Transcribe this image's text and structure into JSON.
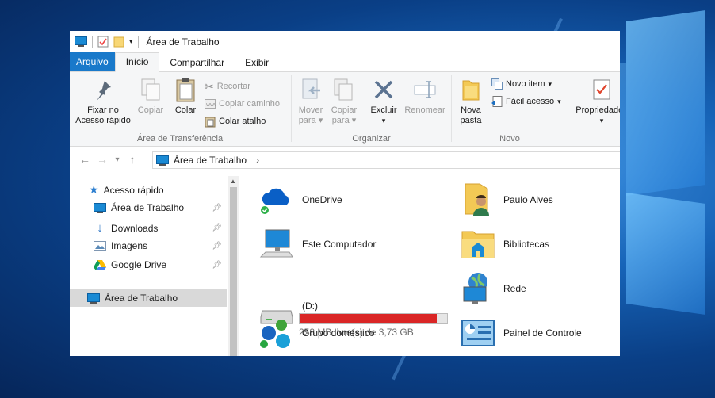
{
  "window": {
    "title": "Área de Trabalho"
  },
  "tabs": {
    "file": "Arquivo",
    "home": "Início",
    "share": "Compartilhar",
    "view": "Exibir"
  },
  "ribbon": {
    "pin": "Fixar no Acesso rápido",
    "copy": "Copiar",
    "paste": "Colar",
    "cut": "Recortar",
    "copy_path": "Copiar caminho",
    "paste_shortcut": "Colar atalho",
    "clipboard_label": "Área de Transferência",
    "move_to": "Mover para",
    "copy_to": "Copiar para",
    "delete": "Excluir",
    "rename": "Renomear",
    "organize_label": "Organizar",
    "new_folder": "Nova pasta",
    "new_item": "Novo item",
    "easy_access": "Fácil acesso",
    "new_label": "Novo",
    "properties": "Propriedades"
  },
  "address": {
    "path": "Área de Trabalho",
    "chevron": "›"
  },
  "nav": {
    "quick_access": "Acesso rápido",
    "items": [
      "Área de Trabalho",
      "Downloads",
      "Imagens",
      "Google Drive"
    ],
    "desktop": "Área de Trabalho"
  },
  "items": {
    "onedrive": "OneDrive",
    "user": "Paulo Alves",
    "computer": "Este Computador",
    "libraries": "Bibliotecas",
    "drive_name": "(D:)",
    "drive_free": "258 MB livre(s) de 3,73 GB",
    "drive_used_fraction": 0.93,
    "network": "Rede",
    "homegroup": "Grupo doméstico",
    "control_panel": "Painel de Controle"
  },
  "colors": {
    "accent": "#1979ca",
    "drive_bar": "#da2626"
  }
}
